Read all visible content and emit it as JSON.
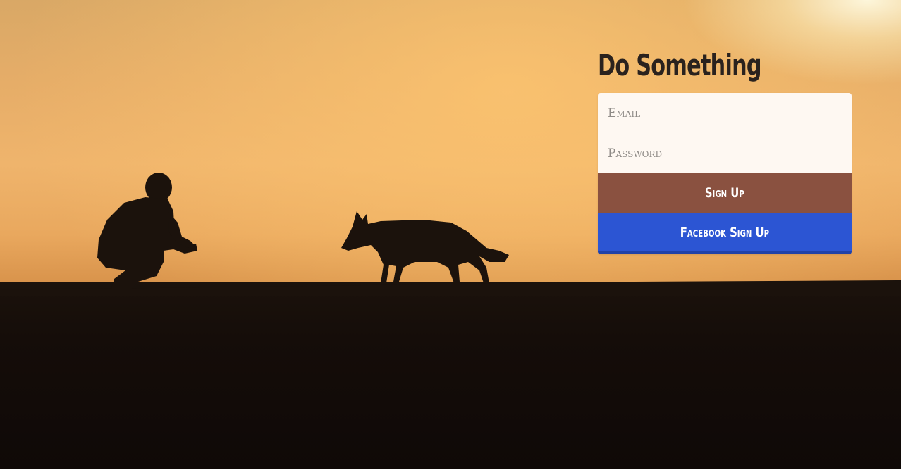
{
  "page": {
    "title": "Do Something"
  },
  "form": {
    "email_placeholder": "Email",
    "password_placeholder": "Password",
    "signup_label": "Sign Up",
    "facebook_label": "Facebook Sign Up"
  },
  "colors": {
    "signup_button": "#8a5140",
    "facebook_button": "#2c55d3",
    "title_text": "#2a221e",
    "input_background": "#fef8f2"
  },
  "background": {
    "description_icon": "sunset-silhouette-person-dog-image"
  }
}
